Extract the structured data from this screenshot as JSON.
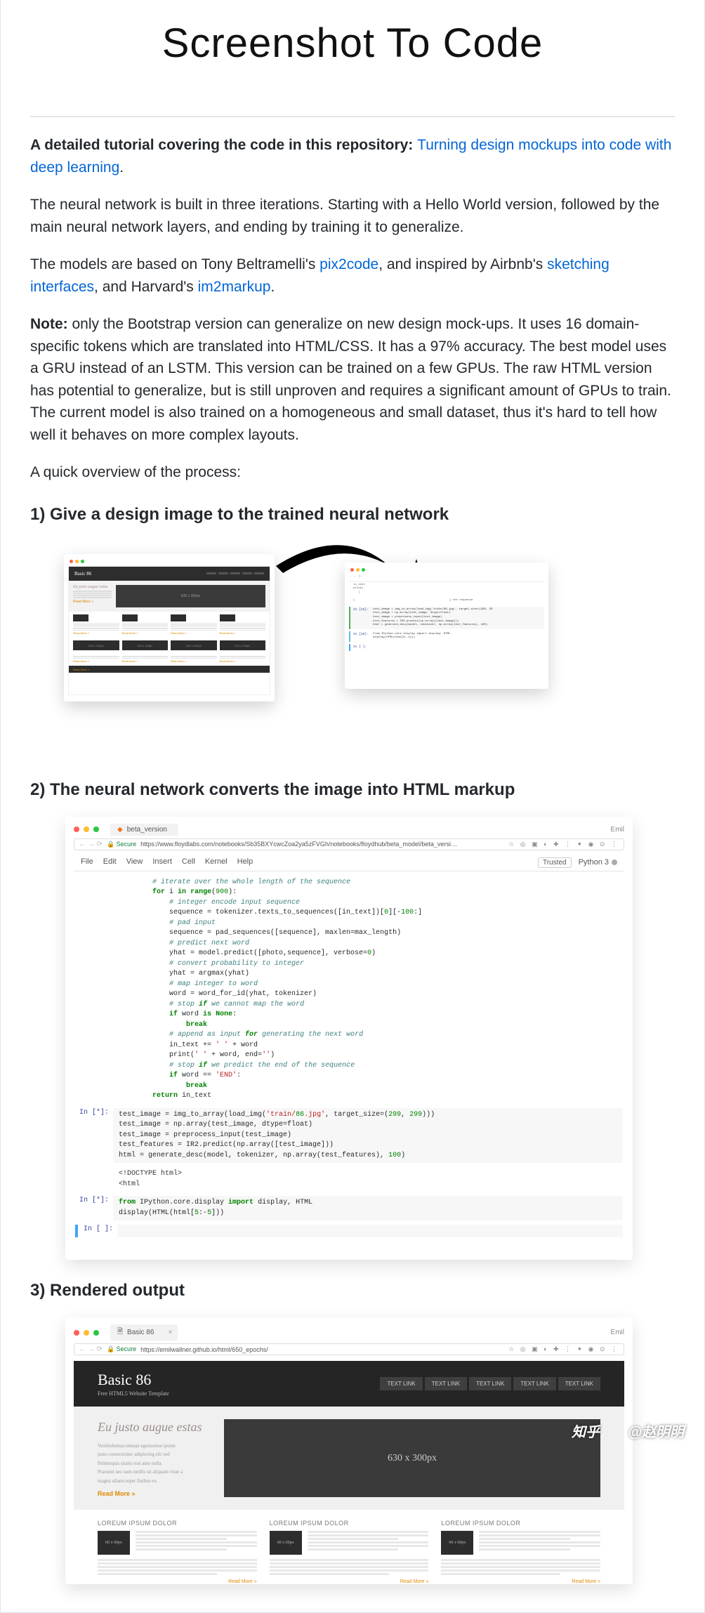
{
  "title": "Screenshot To Code",
  "intro_bold": "A detailed tutorial covering the code in this repository: ",
  "intro_link": "Turning design mockups into code with deep learning",
  "para2": "The neural network is built in three iterations. Starting with a Hello World version, followed by the main neural network layers, and ending by training it to generalize.",
  "para3_a": "The models are based on Tony Beltramelli's ",
  "para3_link1": "pix2code",
  "para3_b": ", and inspired by Airbnb's ",
  "para3_link2": "sketching interfaces",
  "para3_c": ", and Harvard's ",
  "para3_link3": "im2markup",
  "para3_d": ".",
  "note_label": "Note:",
  "note_body": " only the Bootstrap version can generalize on new design mock-ups. It uses 16 domain-specific tokens which are translated into HTML/CSS. It has a 97% accuracy. The best model uses a GRU instead of an LSTM. This version can be trained on a few GPUs. The raw HTML version has potential to generalize, but is still unproven and requires a significant amount of GPUs to train. The current model is also trained on a homogeneous and small dataset, thus it's hard to tell how well it behaves on more complex layouts.",
  "para5": "A quick overview of the process:",
  "h1": "1) Give a design image to the trained neural network",
  "h2": "2) The neural network converts the image into HTML markup",
  "h3": "3) Rendered output",
  "fig1": {
    "left": {
      "brand": "Basic 86",
      "hero_title": "Eu justo augue estas",
      "hero_img": "630 x 300px",
      "btn": "Read More »",
      "more": "Read More »",
      "tile": "215 x 100px"
    },
    "right": {
      "out_lines": "is_test\nprint(\n   )\n\n[                                                        ] the sequence",
      "cell15_prompt": "In [15]:",
      "cell15": "test_image = img_to_array(load_img('train/86.jpg', target_size=(299, 29\ntest_image = np.array(test_image, dtype=float)\ntest_image = preprocess_input(test_image)\ntest_features = IR2.predict(np.array([test_image]))\nhtml = generate_desc(model, tokenizer, np.array(test_features), 100)",
      "cell18_prompt": "In [18]:",
      "cell18": "from IPython.core.display import display, HTML\ndisplay(HTML(html[6:-4]))",
      "cell_empty_prompt": "In [ ]:"
    }
  },
  "fig2": {
    "tab": "beta_version",
    "user": "Emil",
    "url_secure": "Secure",
    "url": "https://www.floydlabs.com/notebooks/Sb35BXYcwcZoa2ya5zFVGh/notebooks/floydhub/beta_model/beta_versi…",
    "url_icons": "☆ ◎ ▣ ◐ ✚ ⋮ ✦ ◉ ⊙ ⋮",
    "menu": [
      "File",
      "Edit",
      "View",
      "Insert",
      "Cell",
      "Kernel",
      "Help"
    ],
    "trusted": "Trusted",
    "kernel": "Python 3",
    "code_main": "        # iterate over the whole length of the sequence\n        for i in range(900):\n            # integer encode input sequence\n            sequence = tokenizer.texts_to_sequences([in_text])[0][-100:]\n            # pad input\n            sequence = pad_sequences([sequence], maxlen=max_length)\n            # predict next word\n            yhat = model.predict([photo,sequence], verbose=0)\n            # convert probability to integer\n            yhat = argmax(yhat)\n            # map integer to word\n            word = word_for_id(yhat, tokenizer)\n            # stop if we cannot map the word\n            if word is None:\n                break\n            # append as input for generating the next word\n            in_text += ' ' + word\n            print(' ' + word, end='')\n            # stop if we predict the end of the sequence\n            if word == 'END':\n                break\n        return in_text",
    "cell_star1_prompt": "In [*]:",
    "cell_star1": "test_image = img_to_array(load_img('train/86.jpg', target_size=(299, 299)))\ntest_image = np.array(test_image, dtype=float)\ntest_image = preprocess_input(test_image)\ntest_features = IR2.predict(np.array([test_image]))\nhtml = generate_desc(model, tokenizer, np.array(test_features), 100)",
    "cell_star1_out": "<!DOCTYPE html>\n<html",
    "cell_star2_prompt": "In [*]:",
    "cell_star2": "from IPython.core.display import display, HTML\ndisplay(HTML(html[5:-5]))",
    "cell_empty_prompt": "In [ ]:"
  },
  "fig3": {
    "tab": "Basic 86",
    "user": "Emil",
    "url_secure": "Secure",
    "url": "https://emilwallner.github.io/html/650_epochs/",
    "url_icons": "☆ ◎ ▣ ◐ ✚ ⋮ ✦ ◉ ⊙ ⋮",
    "brand": "Basic 86",
    "tagline": "Free HTML5 Website Template",
    "nav": [
      "TEXT LINK",
      "TEXT LINK",
      "TEXT LINK",
      "TEXT LINK",
      "TEXT LINK"
    ],
    "hero_title": "Eu justo augue estas",
    "hero_btn": "Read More »",
    "hero_img": "630 x 300px",
    "col_head": "LOREUM IPSUM DOLOR",
    "chip": "60 x 60px",
    "more": "Read More »"
  },
  "watermark_logo": "知乎",
  "watermark_user": "@赵明明"
}
